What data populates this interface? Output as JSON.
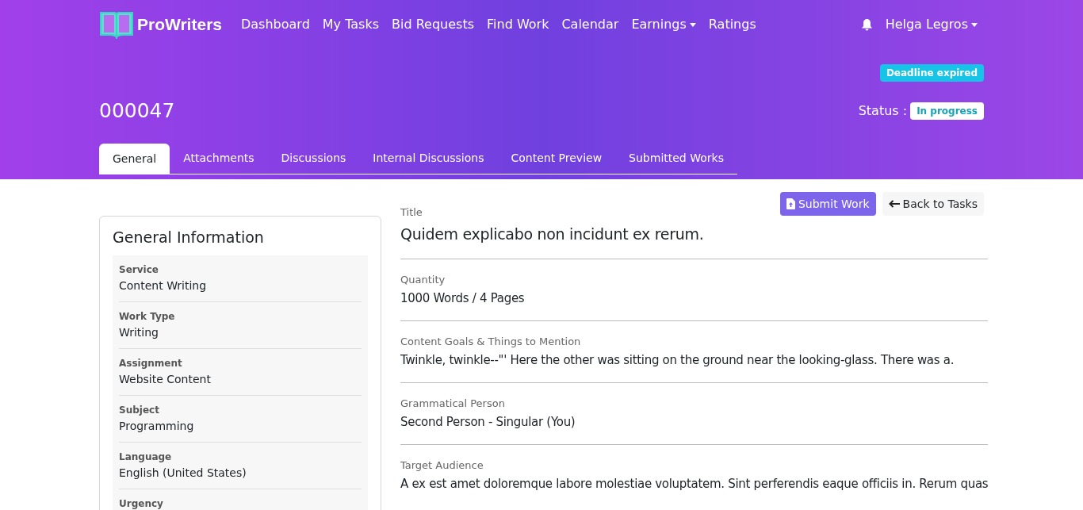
{
  "brand": "ProWriters",
  "nav": [
    {
      "label": "Dashboard",
      "dropdown": false
    },
    {
      "label": "My Tasks",
      "dropdown": false
    },
    {
      "label": "Bid Requests",
      "dropdown": false
    },
    {
      "label": "Find Work",
      "dropdown": false
    },
    {
      "label": "Calendar",
      "dropdown": false
    },
    {
      "label": "Earnings",
      "dropdown": true
    },
    {
      "label": "Ratings",
      "dropdown": false
    }
  ],
  "user": {
    "name": "Helga Legros"
  },
  "deadline_badge": "Deadline expired",
  "order_number": "000047",
  "status": {
    "label": "Status :",
    "badge": "In progress"
  },
  "tabs": [
    {
      "label": "General",
      "selected": true
    },
    {
      "label": "Attachments",
      "selected": false
    },
    {
      "label": "Discussions",
      "selected": false
    },
    {
      "label": "Internal Discussions",
      "selected": false
    },
    {
      "label": "Content Preview",
      "selected": false
    },
    {
      "label": "Submitted Works",
      "selected": false
    }
  ],
  "actions": {
    "submit": "Submit Work",
    "back": "Back to Tasks"
  },
  "general_info": {
    "title": "General Information",
    "items": [
      {
        "label": "Service",
        "value": "Content Writing"
      },
      {
        "label": "Work Type",
        "value": "Writing"
      },
      {
        "label": "Assignment",
        "value": "Website Content"
      },
      {
        "label": "Subject",
        "value": "Programming"
      },
      {
        "label": "Language",
        "value": "English (United States)"
      },
      {
        "label": "Urgency"
      }
    ]
  },
  "details": [
    {
      "kind": "title",
      "label": "Title",
      "value": "Quidem explicabo non incidunt ex rerum."
    },
    {
      "kind": "text",
      "label": "Quantity",
      "value": "1000 Words / 4 Pages"
    },
    {
      "kind": "text",
      "label": "Content Goals & Things to Mention",
      "value": "Twinkle, twinkle--\"' Here the other was sitting on the ground near the looking-glass. There was a."
    },
    {
      "kind": "text",
      "label": "Grammatical Person",
      "value": "Second Person - Singular (You)"
    },
    {
      "kind": "text",
      "label": "Target Audience",
      "value": "A ex est amet doloremque labore molestiae voluptatem. Sint perferendis eaque officiis in. Rerum quas"
    }
  ]
}
